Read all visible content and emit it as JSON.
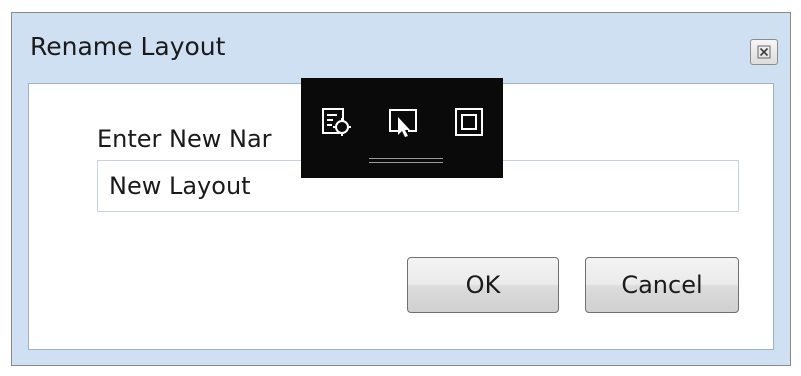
{
  "window": {
    "title": "Rename Layout",
    "close_icon": "close-icon"
  },
  "form": {
    "prompt_label": "Enter New Nar",
    "name_value": "New Layout"
  },
  "buttons": {
    "ok_label": "OK",
    "cancel_label": "Cancel"
  },
  "overlay_toolbar": {
    "icons": [
      "select-element-icon",
      "pointer-select-icon",
      "layout-adorner-icon"
    ]
  },
  "colors": {
    "dialog_frame": "#cfe0f3",
    "toolbar_bg": "#0a0a0a"
  }
}
